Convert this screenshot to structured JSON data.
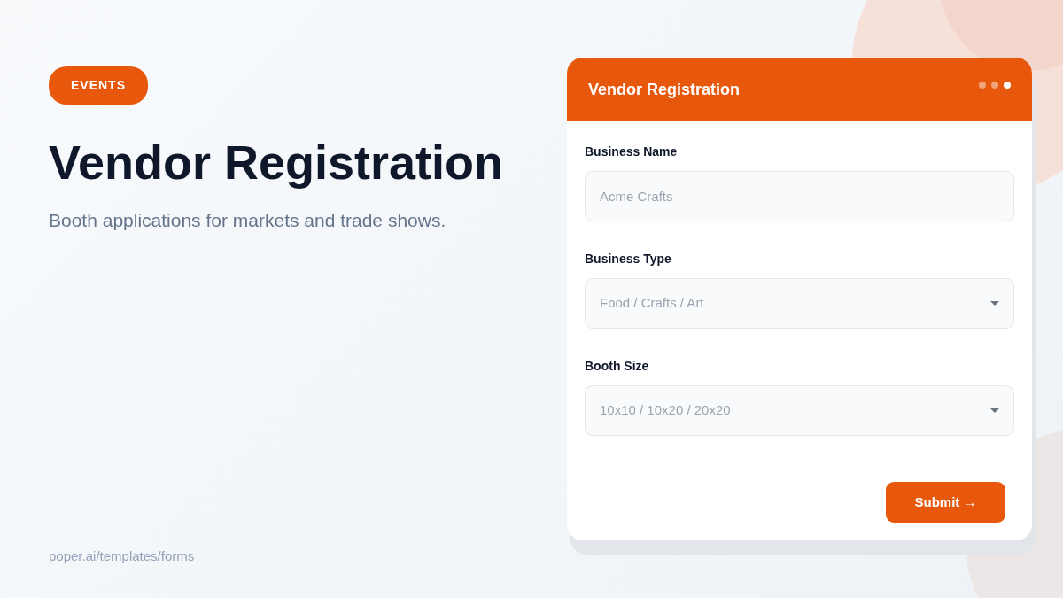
{
  "tag": "EVENTS",
  "title": "Vendor Registration",
  "subtitle": "Booth applications for markets and trade shows.",
  "footer_link": "poper.ai/templates/forms",
  "form": {
    "title": "Vendor Registration",
    "steps": [
      {
        "selected": false
      },
      {
        "selected": false
      },
      {
        "selected": true
      }
    ],
    "fields": [
      {
        "kind": "input",
        "label": "Business Name",
        "placeholder": "Acme Crafts"
      },
      {
        "kind": "select",
        "label": "Business Type",
        "placeholder": "Food / Crafts / Art"
      },
      {
        "kind": "select",
        "label": "Booth Size",
        "placeholder": "10x10 / 10x20 / 20x20"
      }
    ],
    "submit": "Submit →"
  }
}
